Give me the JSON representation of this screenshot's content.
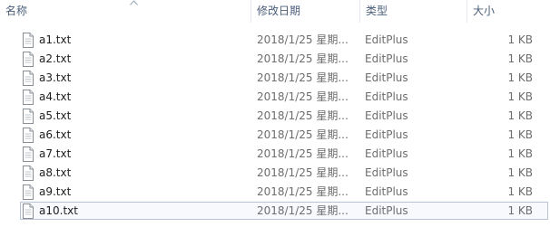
{
  "columns": {
    "name": "名称",
    "modified": "修改日期",
    "type": "类型",
    "size": "大小"
  },
  "files": [
    {
      "name": "a1.txt",
      "modified": "2018/1/25 星期...",
      "type": "EditPlus",
      "size": "1 KB"
    },
    {
      "name": "a2.txt",
      "modified": "2018/1/25 星期...",
      "type": "EditPlus",
      "size": "1 KB"
    },
    {
      "name": "a3.txt",
      "modified": "2018/1/25 星期...",
      "type": "EditPlus",
      "size": "1 KB"
    },
    {
      "name": "a4.txt",
      "modified": "2018/1/25 星期...",
      "type": "EditPlus",
      "size": "1 KB"
    },
    {
      "name": "a5.txt",
      "modified": "2018/1/25 星期...",
      "type": "EditPlus",
      "size": "1 KB"
    },
    {
      "name": "a6.txt",
      "modified": "2018/1/25 星期...",
      "type": "EditPlus",
      "size": "1 KB"
    },
    {
      "name": "a7.txt",
      "modified": "2018/1/25 星期...",
      "type": "EditPlus",
      "size": "1 KB"
    },
    {
      "name": "a8.txt",
      "modified": "2018/1/25 星期...",
      "type": "EditPlus",
      "size": "1 KB"
    },
    {
      "name": "a9.txt",
      "modified": "2018/1/25 星期...",
      "type": "EditPlus",
      "size": "1 KB"
    },
    {
      "name": "a10.txt",
      "modified": "2018/1/25 星期...",
      "type": "EditPlus",
      "size": "1 KB",
      "selected": true
    }
  ],
  "icons": {
    "file": "text-file-icon",
    "sort": "sort-ascending-icon"
  }
}
